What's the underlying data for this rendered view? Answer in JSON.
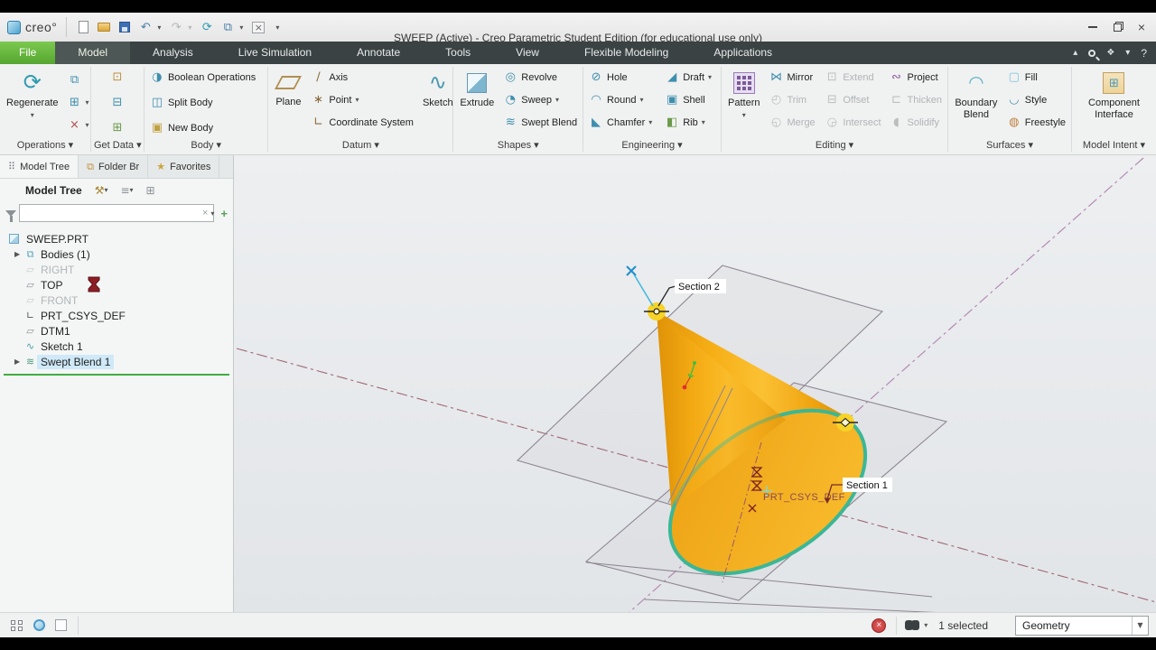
{
  "window": {
    "title": "SWEEP (Active) - Creo Parametric Student Edition (for educational use only)",
    "logo": "creo°"
  },
  "tabs": {
    "file": "File",
    "model": "Model",
    "analysis": "Analysis",
    "live_simulation": "Live Simulation",
    "annotate": "Annotate",
    "tools": "Tools",
    "view": "View",
    "flexible_modeling": "Flexible Modeling",
    "applications": "Applications",
    "help": "?"
  },
  "ribbon": {
    "operations": {
      "label": "Operations",
      "regenerate": "Regenerate"
    },
    "get_data": {
      "label": "Get Data"
    },
    "body": {
      "label": "Body",
      "boolean_operations": "Boolean Operations",
      "split_body": "Split Body",
      "new_body": "New Body"
    },
    "datum": {
      "label": "Datum",
      "plane": "Plane",
      "axis": "Axis",
      "point": "Point",
      "coordinate_system": "Coordinate System",
      "sketch": "Sketch"
    },
    "shapes": {
      "label": "Shapes",
      "extrude": "Extrude",
      "revolve": "Revolve",
      "sweep": "Sweep",
      "swept_blend": "Swept Blend"
    },
    "engineering": {
      "label": "Engineering",
      "hole": "Hole",
      "round": "Round",
      "chamfer": "Chamfer",
      "draft": "Draft",
      "shell": "Shell",
      "rib": "Rib"
    },
    "editing": {
      "label": "Editing",
      "pattern": "Pattern",
      "mirror": "Mirror",
      "trim": "Trim",
      "merge": "Merge",
      "extend": "Extend",
      "offset": "Offset",
      "intersect": "Intersect",
      "project": "Project",
      "thicken": "Thicken",
      "solidify": "Solidify"
    },
    "surfaces": {
      "label": "Surfaces",
      "boundary_blend": "Boundary Blend",
      "fill": "Fill",
      "style": "Style",
      "freestyle": "Freestyle"
    },
    "model_intent": {
      "label": "Model Intent",
      "component_interface": "Component Interface"
    }
  },
  "sidebar": {
    "tabs": {
      "model_tree": "Model Tree",
      "folder_browser": "Folder Br",
      "favorites": "Favorites"
    },
    "header": "Model Tree",
    "filter_value": "",
    "items": [
      {
        "label": "SWEEP.PRT"
      },
      {
        "label": "Bodies (1)"
      },
      {
        "label": "RIGHT"
      },
      {
        "label": "TOP"
      },
      {
        "label": "FRONT"
      },
      {
        "label": "PRT_CSYS_DEF"
      },
      {
        "label": "DTM1"
      },
      {
        "label": "Sketch 1"
      },
      {
        "label": "Swept Blend 1"
      }
    ]
  },
  "viewport": {
    "section1": "Section 1",
    "section2": "Section 2",
    "csys_label": "PRT_CSYS_DEF"
  },
  "status": {
    "selected": "1 selected",
    "filter": "Geometry"
  },
  "colors": {
    "accent_green": "#6cbe4c",
    "selection_blue": "#cfe9f8",
    "cone_orange": "#f2a40e",
    "base_edge_teal": "#3bb796",
    "centerline_purple": "#b48ab4",
    "centerline_maroon": "#9a5a64",
    "marker_yellow": "#f6d326",
    "tab_bar": "#3a4243"
  }
}
